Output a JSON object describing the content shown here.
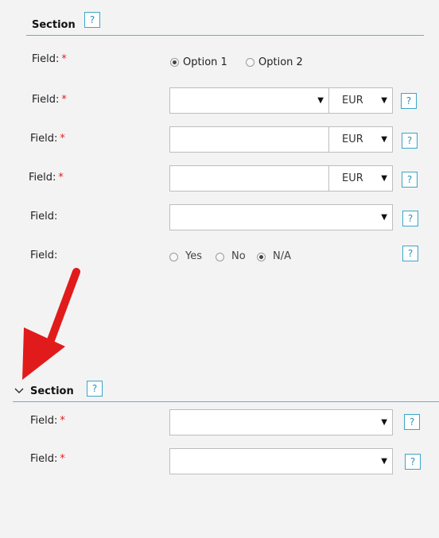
{
  "section1": {
    "title": "Section",
    "help": "?"
  },
  "section2": {
    "title": "Section",
    "help": "?"
  },
  "field_label": "Field:",
  "required_mark": "*",
  "help": "?",
  "option1": "Option 1",
  "option2": "Option 2",
  "currency": "EUR",
  "yes": "Yes",
  "no": "No",
  "na": "N/A",
  "caret": "▼",
  "radio_selected": {
    "options": "Option 1",
    "yes_no": "N/A"
  },
  "colors": {
    "accent": "#39a6c8",
    "required": "#dd2222",
    "arrow": "#e11b1b"
  }
}
